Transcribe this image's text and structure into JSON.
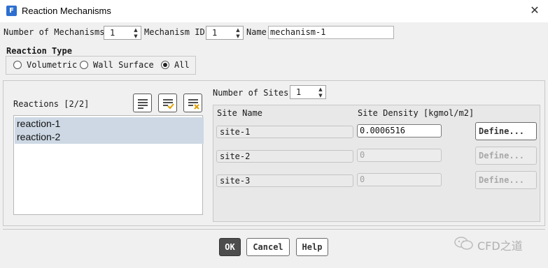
{
  "window": {
    "title": "Reaction Mechanisms",
    "app_icon": "F",
    "close_glyph": "✕"
  },
  "top": {
    "num_mech_label": "Number of Mechanisms",
    "num_mech_value": "1",
    "mech_id_label": "Mechanism ID",
    "mech_id_value": "1",
    "name_label": "Name",
    "name_value": "mechanism-1"
  },
  "reaction_type": {
    "label": "Reaction Type",
    "options": [
      "Volumetric",
      "Wall Surface",
      "All"
    ],
    "selected": "All"
  },
  "reactions": {
    "label": "Reactions [2/2]",
    "items": [
      "reaction-1",
      "reaction-2"
    ],
    "icons": [
      "select-all-icon",
      "select-checked-icon",
      "deselect-all-icon"
    ]
  },
  "sites": {
    "num_label": "Number of Sites",
    "num_value": "1",
    "col_name": "Site Name",
    "col_density": "Site Density [kgmol/m2]",
    "rows": [
      {
        "name": "site-1",
        "density": "0.0006516",
        "define": "Define...",
        "enabled": true
      },
      {
        "name": "site-2",
        "density": "0",
        "define": "Define...",
        "enabled": false
      },
      {
        "name": "site-3",
        "density": "0",
        "define": "Define...",
        "enabled": false
      }
    ]
  },
  "buttons": {
    "ok": "OK",
    "cancel": "Cancel",
    "help": "Help"
  },
  "watermark": {
    "text": "CFD之道",
    "icon": "wechat-icon"
  }
}
